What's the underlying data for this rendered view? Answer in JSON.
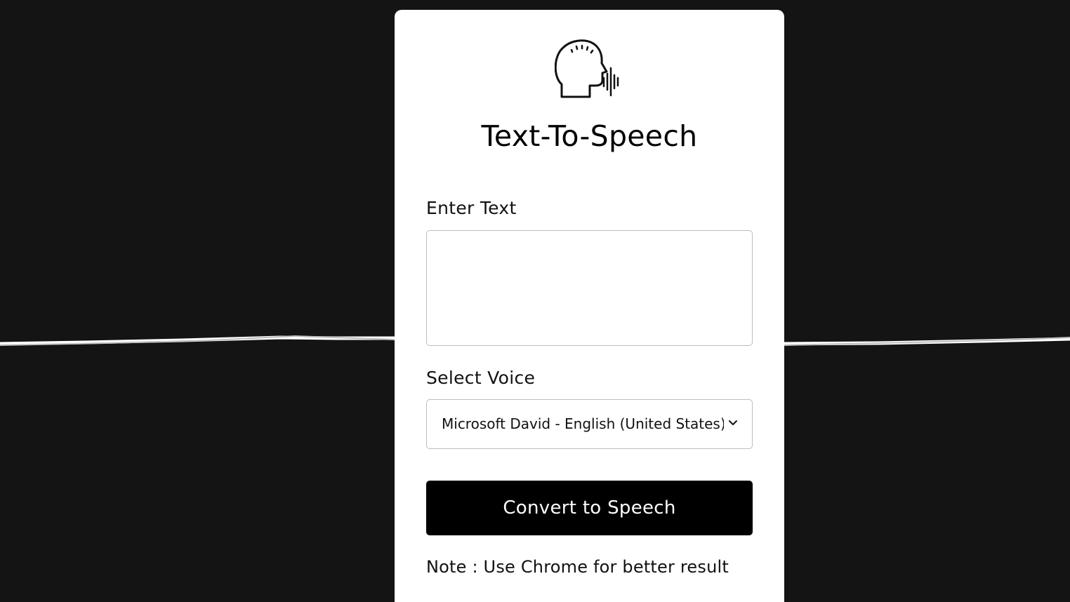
{
  "app": {
    "icon": "speaking-head-soundwave-icon",
    "title": "Text-To-Speech"
  },
  "form": {
    "text_label": "Enter Text",
    "text_value": "",
    "voice_label": "Select Voice",
    "voice_selected": "Microsoft David - English (United States)",
    "convert_label": "Convert to Speech",
    "note": "Note : Use Chrome for better result"
  },
  "colors": {
    "background": "#141414",
    "card": "#ffffff",
    "button": "#000000",
    "button_text": "#ffffff",
    "waveform": "#ffffff"
  }
}
